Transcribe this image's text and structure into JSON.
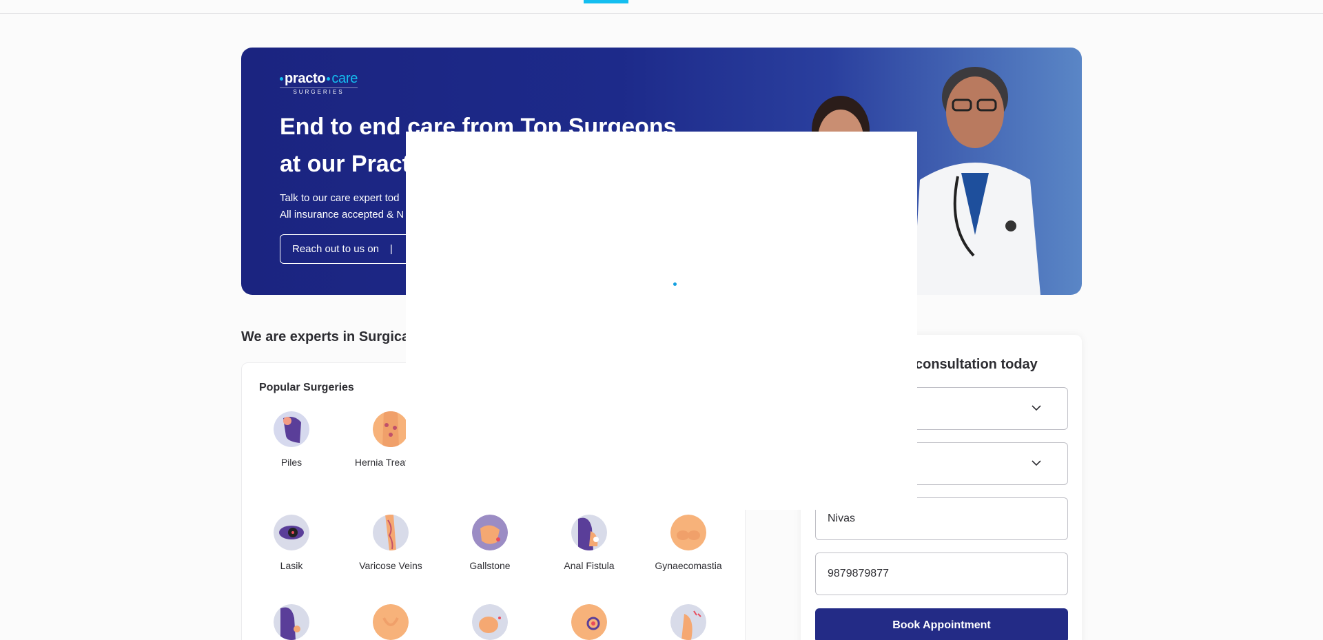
{
  "colors": {
    "accent": "#14bef0",
    "primary_navy": "#232b86",
    "hero_bg": "#1b2480"
  },
  "hero": {
    "logo": {
      "word1": "practo",
      "word2": "care",
      "sub": "SURGERIES"
    },
    "title_line1": "End to end care from Top Surgeons",
    "title_line2": "at our Pract",
    "desc_line1": "Talk to our care expert tod",
    "desc_line2": "All insurance accepted & N",
    "reach_label": "Reach out to us on",
    "reach_sep": "|"
  },
  "section": {
    "title": "We are experts in Surgical s"
  },
  "surgeries": {
    "title": "Popular Surgeries",
    "items": [
      {
        "label": "Piles",
        "icon": "piles-icon"
      },
      {
        "label": "Hernia Treatmen",
        "icon": "hernia-icon"
      },
      {
        "label": "Lasik",
        "icon": "lasik-icon"
      },
      {
        "label": "Varicose Veins",
        "icon": "varicose-veins-icon"
      },
      {
        "label": "Gallstone",
        "icon": "gallstone-icon"
      },
      {
        "label": "Anal Fistula",
        "icon": "anal-fistula-icon"
      },
      {
        "label": "Gynaecomastia",
        "icon": "gynaecomastia-icon"
      },
      {
        "label": "",
        "icon": "surgery-icon"
      },
      {
        "label": "",
        "icon": "surgery-icon"
      },
      {
        "label": "",
        "icon": "surgery-icon"
      },
      {
        "label": "",
        "icon": "surgery-icon"
      },
      {
        "label": "",
        "icon": "surgery-icon"
      }
    ]
  },
  "form": {
    "title": "consultation today",
    "name_value": "Nivas",
    "phone_value": "9879879877",
    "book_label": "Book Appointment"
  }
}
